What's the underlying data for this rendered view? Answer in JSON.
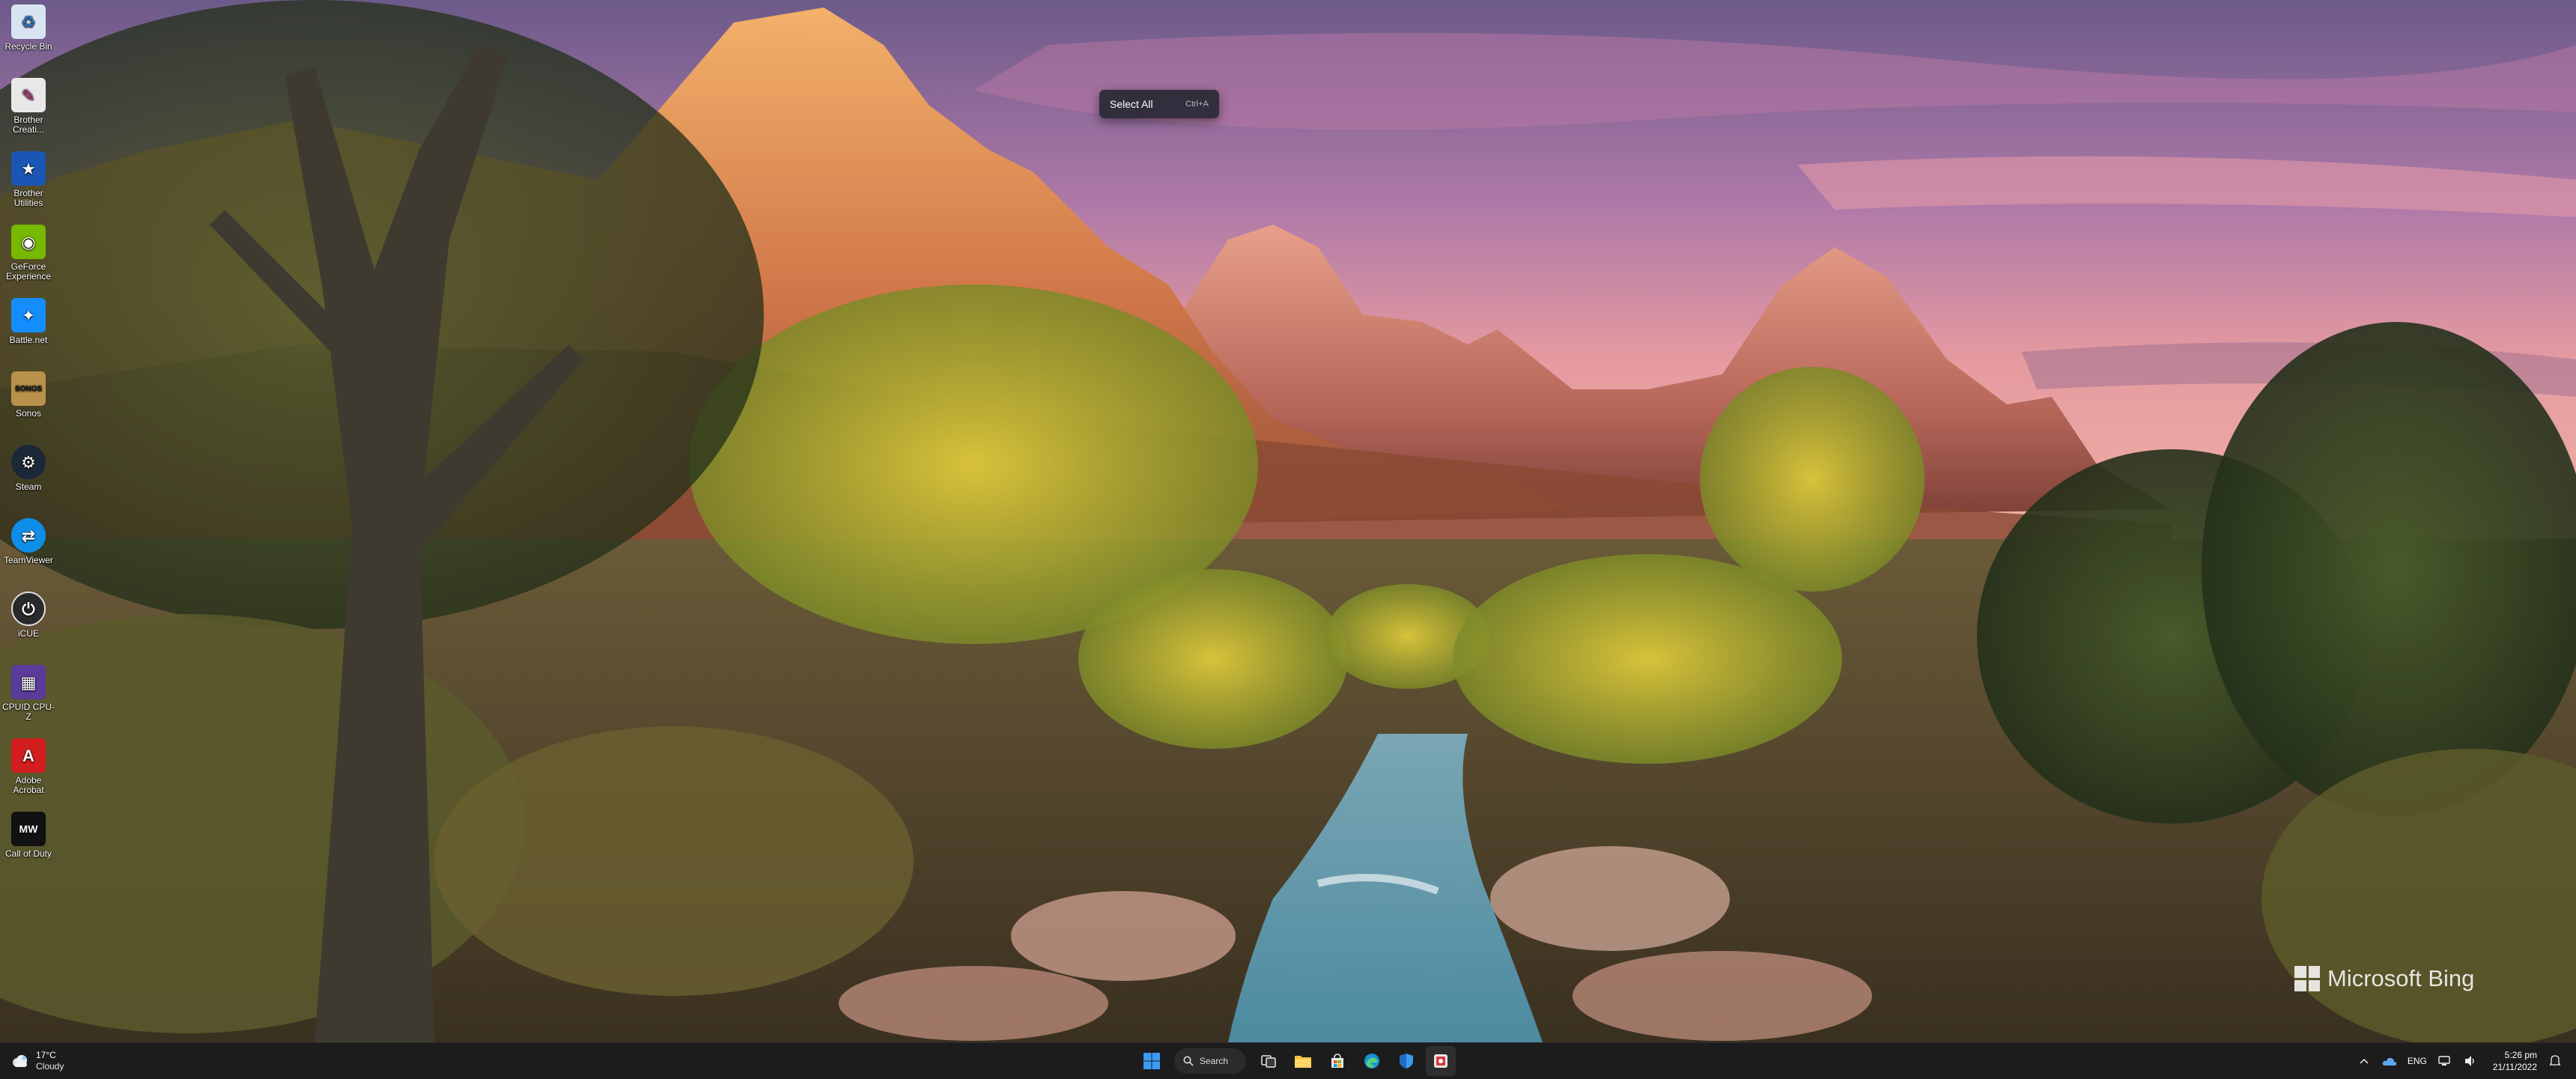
{
  "desktop": {
    "icons": [
      {
        "label": "Recycle Bin",
        "icon": "recycle-bin-icon",
        "color": "#d8e4f2"
      },
      {
        "label": "Brother Creati...",
        "icon": "brother-creative-icon",
        "color": "#e8e8e8"
      },
      {
        "label": "Brother Utilities",
        "icon": "brother-utilities-icon",
        "color": "#1a56b4"
      },
      {
        "label": "GeForce Experience",
        "icon": "geforce-icon",
        "color": "#76b900"
      },
      {
        "label": "Battle.net",
        "icon": "battlenet-icon",
        "color": "#148eff"
      },
      {
        "label": "Sonos",
        "icon": "sonos-icon",
        "color": "#b8924a"
      },
      {
        "label": "Steam",
        "icon": "steam-icon",
        "color": "#1b2838"
      },
      {
        "label": "TeamViewer",
        "icon": "teamviewer-icon",
        "color": "#0e8ee9"
      },
      {
        "label": "iCUE",
        "icon": "icue-icon",
        "color": "#2a2a2a"
      },
      {
        "label": "CPUID CPU-Z",
        "icon": "cpuz-icon",
        "color": "#5a3a9a"
      },
      {
        "label": "Adobe Acrobat",
        "icon": "acrobat-icon",
        "color": "#d21e1e"
      },
      {
        "label": "Call of Duty",
        "icon": "callofduty-icon",
        "color": "#111111"
      }
    ],
    "icon_glyphs": [
      "♻",
      "✎",
      "★",
      "◉",
      "✦",
      "SONOS",
      "⚙",
      "⇄",
      "⏻",
      "▦",
      "A",
      "MW"
    ]
  },
  "context_popup": {
    "label": "Select All",
    "shortcut": "Ctrl+A"
  },
  "watermark": {
    "text": "Microsoft Bing"
  },
  "taskbar": {
    "weather": {
      "temperature": "17°C",
      "condition": "Cloudy"
    },
    "search_label": "Search",
    "apps": [
      {
        "name": "task-view-icon"
      },
      {
        "name": "file-explorer-icon"
      },
      {
        "name": "microsoft-store-icon"
      },
      {
        "name": "edge-icon"
      },
      {
        "name": "shield-app-icon"
      },
      {
        "name": "snipping-tool-icon"
      }
    ],
    "tray": {
      "language": "ENG",
      "time": "5:26 pm",
      "date": "21/11/2022"
    }
  },
  "colors": {
    "taskbar_bg": "#1c1c1c",
    "windows_blue": "#3a9bf2",
    "popup_bg": "#28283a"
  }
}
